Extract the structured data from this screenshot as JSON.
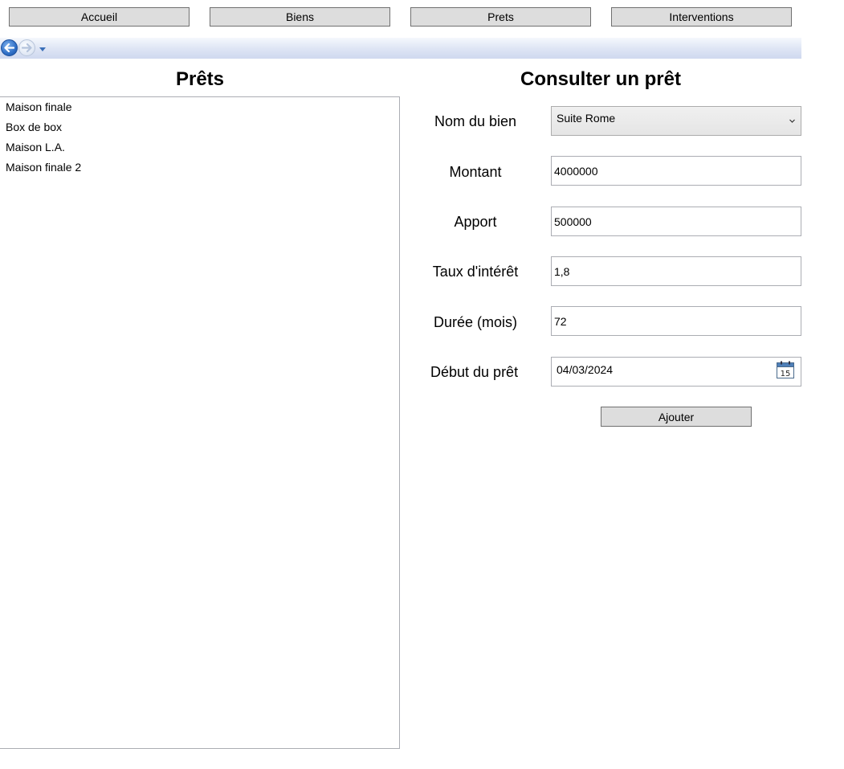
{
  "nav_buttons": {
    "home_label": "Accueil",
    "goods_label": "Biens",
    "loans_label": "Prets",
    "interventions_label": "Interventions"
  },
  "loans_list": {
    "title": "Prêts",
    "items": [
      "Maison finale",
      "Box de box",
      "Maison L.A.",
      "Maison finale 2"
    ]
  },
  "loan_form": {
    "title": "Consulter un prêt",
    "property_label": "Nom du bien",
    "property_value": "Suite Rome",
    "amount_label": "Montant",
    "amount_value": "4000000",
    "down_payment_label": "Apport",
    "down_payment_value": "500000",
    "interest_rate_label": "Taux d'intérêt",
    "interest_rate_value": "1,8",
    "duration_label": "Durée (mois)",
    "duration_value": "72",
    "start_date_label": "Début du prêt",
    "start_date_value": "04/03/2024",
    "calendar_day": "15",
    "add_label": "Ajouter"
  }
}
